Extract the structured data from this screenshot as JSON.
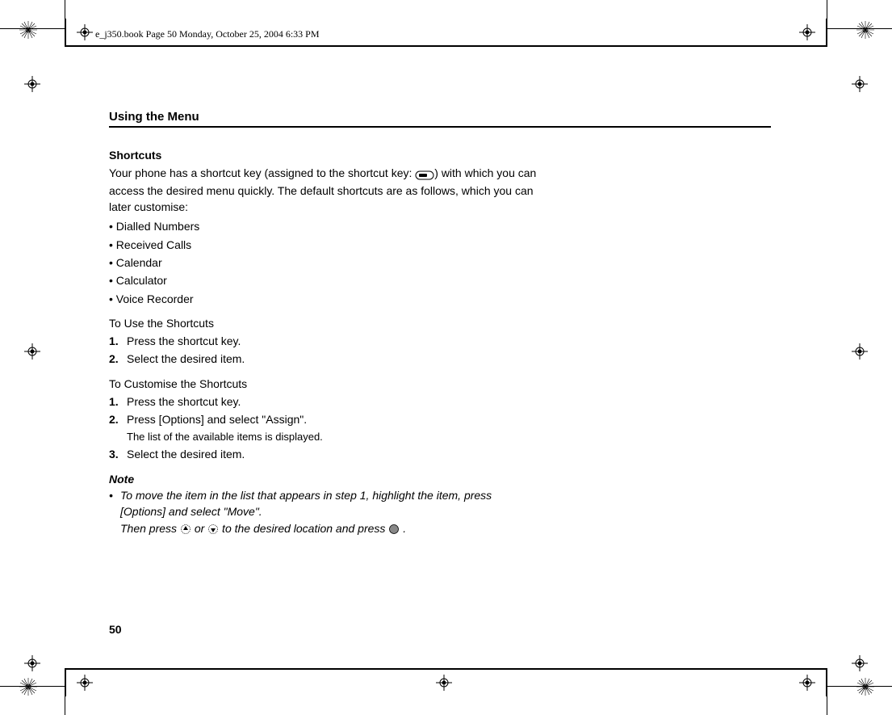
{
  "doc_header": "e_j350.book  Page 50  Monday, October 25, 2004  6:33 PM",
  "section_heading": "Using the Menu",
  "page_number": "50",
  "h1": "Shortcuts",
  "intro_a": "Your phone has a shortcut key (assigned to the shortcut key: ",
  "intro_b": ") with which you can access the desired menu quickly. The default shortcuts are as follows, which you can later customise:",
  "bullets": [
    "Dialled Numbers",
    "Received Calls",
    "Calendar",
    "Calculator",
    "Voice Recorder"
  ],
  "use_title": "To Use the Shortcuts",
  "use_steps": [
    {
      "n": "1.",
      "t": "Press the shortcut key."
    },
    {
      "n": "2.",
      "t": "Select the desired item."
    }
  ],
  "custom_title": "To Customise the Shortcuts",
  "custom_steps": [
    {
      "n": "1.",
      "t": "Press the shortcut key."
    },
    {
      "n": "2.",
      "t": "Press [Options] and select \"Assign\".",
      "d": "The list of the available items is displayed."
    },
    {
      "n": "3.",
      "t": "Select the desired item."
    }
  ],
  "note_title": "Note",
  "note_a": "To move the item in the list that appears in step 1, highlight the item, press [Options] and select \"Move\".",
  "note_b_pre": "Then press ",
  "note_b_mid": " or ",
  "note_b_post": " to the desired location and press ",
  "note_b_end": " ."
}
